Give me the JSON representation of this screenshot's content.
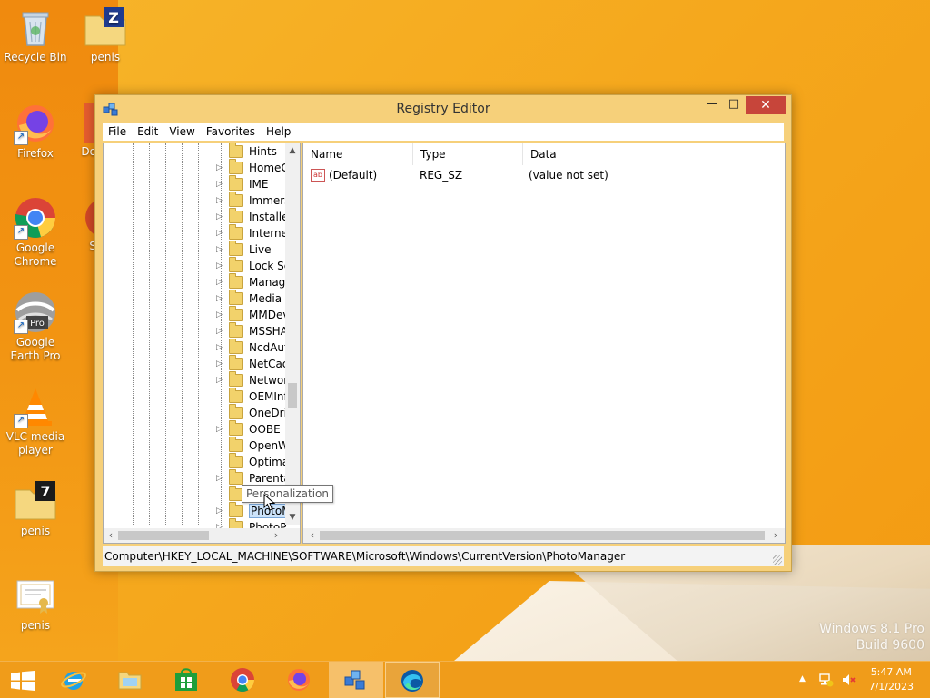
{
  "desktop": {
    "icons": [
      {
        "label": "Recycle Bin"
      },
      {
        "label": "penis"
      },
      {
        "label": "Firefox"
      },
      {
        "label": "Do"
      },
      {
        "label": "Google Chrome"
      },
      {
        "label": "S"
      },
      {
        "label": "Google Earth Pro"
      },
      {
        "label": "VLC media player"
      },
      {
        "label": "penis"
      },
      {
        "label": "penis"
      }
    ],
    "watermark": {
      "line1": "Windows 8.1 Pro",
      "line2": "Build 9600"
    }
  },
  "window": {
    "title": "Registry Editor",
    "controls": {
      "minimize": "—",
      "maximize": "□",
      "close": "✕"
    },
    "menu": [
      "File",
      "Edit",
      "View",
      "Favorites",
      "Help"
    ],
    "tree": {
      "items": [
        {
          "label": "Hints",
          "expandable": false
        },
        {
          "label": "HomeG",
          "expandable": true
        },
        {
          "label": "IME",
          "expandable": true
        },
        {
          "label": "Immers",
          "expandable": true
        },
        {
          "label": "Installer",
          "expandable": true
        },
        {
          "label": "Internet",
          "expandable": true
        },
        {
          "label": "Live",
          "expandable": true
        },
        {
          "label": "Lock Sc",
          "expandable": true
        },
        {
          "label": "Manage",
          "expandable": true
        },
        {
          "label": "Media C",
          "expandable": true
        },
        {
          "label": "MMDev",
          "expandable": true
        },
        {
          "label": "MSSHA",
          "expandable": true
        },
        {
          "label": "NcdAut",
          "expandable": true
        },
        {
          "label": "NetCac",
          "expandable": true
        },
        {
          "label": "Networ",
          "expandable": true
        },
        {
          "label": "OEMInf",
          "expandable": false
        },
        {
          "label": "OneDriv",
          "expandable": false
        },
        {
          "label": "OOBE",
          "expandable": true
        },
        {
          "label": "OpenW",
          "expandable": false
        },
        {
          "label": "Optima",
          "expandable": false
        },
        {
          "label": "Parenta",
          "expandable": true
        },
        {
          "label": "Personalization",
          "expandable": false
        },
        {
          "label": "PhotoM",
          "expandable": true,
          "selected": true
        },
        {
          "label": "PhotoP",
          "expandable": true
        }
      ]
    },
    "values": {
      "columns": [
        "Name",
        "Type",
        "Data"
      ],
      "rows": [
        {
          "name": "(Default)",
          "type": "REG_SZ",
          "data": "(value not set)",
          "icon": "ab"
        }
      ]
    },
    "tooltip": "Personalization",
    "status_path": "Computer\\HKEY_LOCAL_MACHINE\\SOFTWARE\\Microsoft\\Windows\\CurrentVersion\\PhotoManager"
  },
  "taskbar": {
    "buttons": [
      {
        "name": "start-button",
        "icon": "windows-logo"
      },
      {
        "name": "internet-explorer",
        "icon": "ie-icon"
      },
      {
        "name": "file-explorer",
        "icon": "folder-icon"
      },
      {
        "name": "store",
        "icon": "store-icon"
      },
      {
        "name": "chrome",
        "icon": "chrome-icon"
      },
      {
        "name": "firefox",
        "icon": "firefox-icon"
      },
      {
        "name": "registry-editor",
        "icon": "regedit-icon"
      },
      {
        "name": "edge",
        "icon": "edge-icon"
      }
    ],
    "clock": {
      "time": "5:47 AM",
      "date": "7/1/2023"
    },
    "tray_chevron": "▲"
  }
}
